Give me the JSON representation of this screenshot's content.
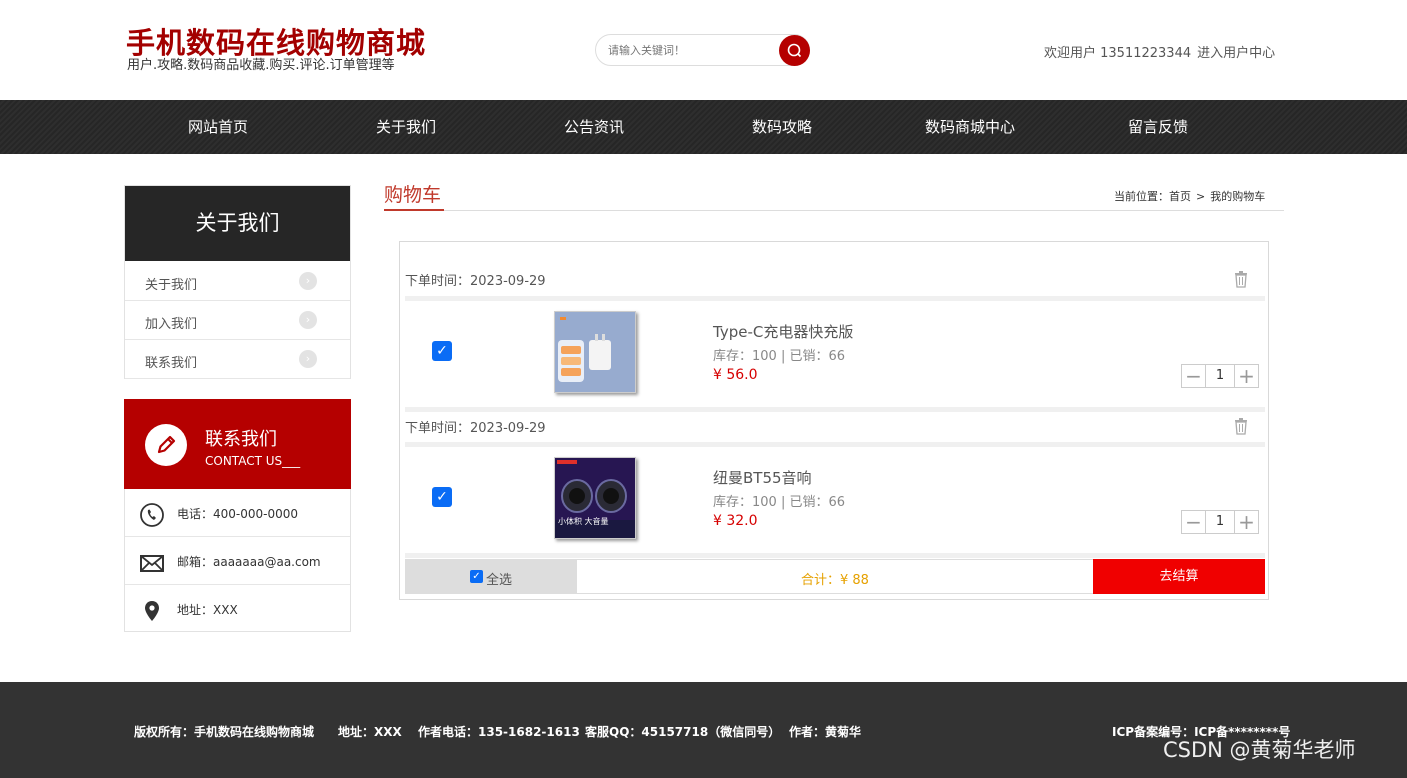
{
  "header": {
    "site_title": "手机数码在线购物商城",
    "site_subtitle": "用户.攻略.数码商品收藏.购买.评论.订单管理等",
    "search_placeholder": "请输入关键词！",
    "welcome": "欢迎用户 13511223344",
    "user_center_link": "进入用户中心"
  },
  "nav": {
    "items": [
      "网站首页",
      "关于我们",
      "公告资讯",
      "数码攻略",
      "数码商城中心",
      "留言反馈"
    ]
  },
  "sidebar": {
    "about_title": "关于我们",
    "about_links": [
      "关于我们",
      "加入我们",
      "联系我们"
    ],
    "contact_title": "联系我们",
    "contact_subtitle": "CONTACT US___",
    "phone": "电话：400-000-0000",
    "email": "邮箱：aaaaaaa@aa.com",
    "address": "地址：XXX"
  },
  "main": {
    "heading": "购物车",
    "breadcrumb": {
      "label": "当前位置：",
      "home": "首页",
      "sep": ">",
      "current": "我的购物车"
    }
  },
  "cart": {
    "orders": [
      {
        "time": "下单时间：2023-09-29",
        "name": "Type-C充电器快充版",
        "meta": "库存：100 | 已销：66",
        "price": "¥ 56.0",
        "qty": "1",
        "checked": true
      },
      {
        "time": "下单时间：2023-09-29",
        "name": "纽曼BT55音响",
        "meta": "库存：100 | 已销：66",
        "price": "¥ 32.0",
        "qty": "1",
        "checked": true
      }
    ],
    "select_all": "全选",
    "total": "合计：¥ 88",
    "checkout": "去结算"
  },
  "footer": {
    "copyright": "版权所有：手机数码在线购物商城",
    "address": "地址：XXX",
    "author_phone": "作者电话：135-1682-1613",
    "qq": "客服QQ：45157718（微信同号）",
    "author": "作者：黄菊华",
    "icp": "ICP备案编号：ICP备********号"
  },
  "watermark": "CSDN @黄菊华老师",
  "colors": {
    "brand_red": "#b50000",
    "checkout_red": "#f00000",
    "price_red": "#d60000",
    "total_orange": "#e6a100",
    "nav_bg": "#262626"
  },
  "product_image_text": {
    "speaker_badge": "小体积 大音量"
  }
}
